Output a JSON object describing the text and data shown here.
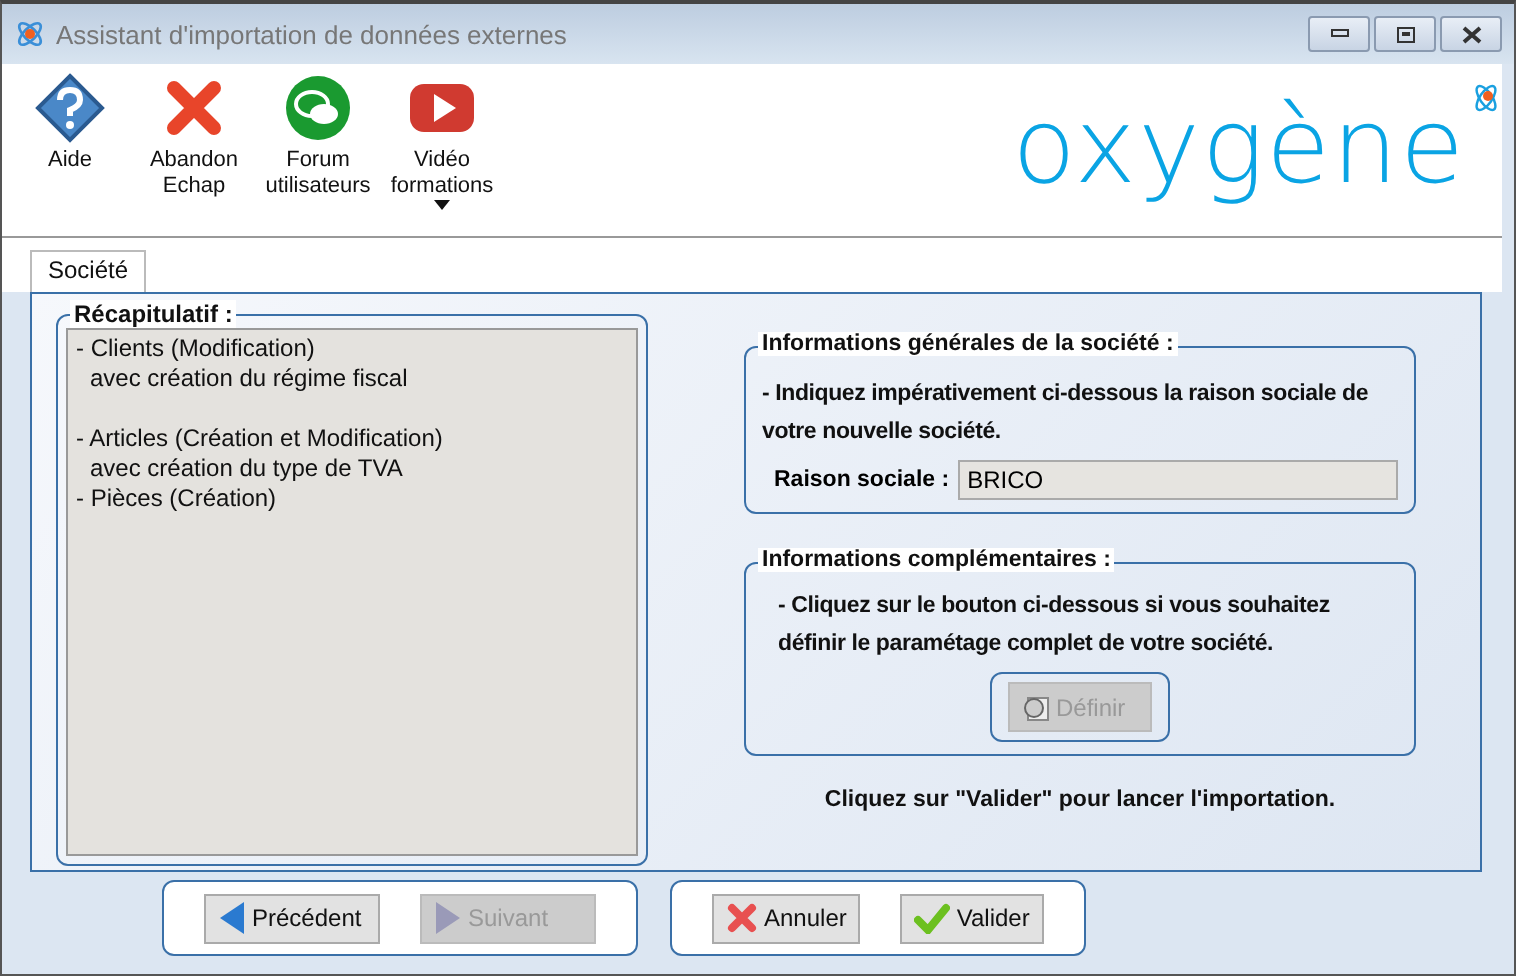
{
  "window": {
    "title": "Assistant d'importation de données externes"
  },
  "toolbar": [
    {
      "kind": "help",
      "label": "Aide"
    },
    {
      "kind": "abort",
      "label": "Abandon\nEchap"
    },
    {
      "kind": "forum",
      "label": "Forum\nutilisateurs"
    },
    {
      "kind": "video",
      "label": "Vidéo\nformations",
      "dropdown": true
    }
  ],
  "logo": "oxygène",
  "tabs": [
    {
      "label": "Société",
      "selected": true
    }
  ],
  "summary": {
    "title": "Récapitulatif :",
    "items": [
      {
        "text": "- Clients (Modification)",
        "sub": "avec création du régime fiscal",
        "gap_after": true
      },
      {
        "text": "- Articles (Création et Modification)",
        "sub": "avec création du type de TVA",
        "gap_after": false
      },
      {
        "text": "- Pièces (Création)",
        "gap_after": false
      }
    ]
  },
  "general": {
    "title": "Informations générales de la société :",
    "text": "- Indiquez impérativement ci-dessous la raison sociale de votre nouvelle société.",
    "field_label": "Raison sociale :",
    "field_value": "BRICO"
  },
  "extra": {
    "title": "Informations complémentaires :",
    "text": "- Cliquez sur le bouton ci-dessous si vous souhaitez définir le paramétage complet de votre société.",
    "button": {
      "label": "Définir",
      "disabled": true
    }
  },
  "hint": "Cliquez sur \"Valider\" pour lancer l'importation.",
  "nav_buttons": [
    {
      "kind": "prev",
      "label": "Précédent",
      "disabled": false
    },
    {
      "kind": "next",
      "label": "Suivant",
      "disabled": true
    }
  ],
  "action_buttons": [
    {
      "kind": "cancel",
      "label": "Annuler",
      "disabled": false
    },
    {
      "kind": "ok",
      "label": "Valider",
      "disabled": false
    }
  ]
}
